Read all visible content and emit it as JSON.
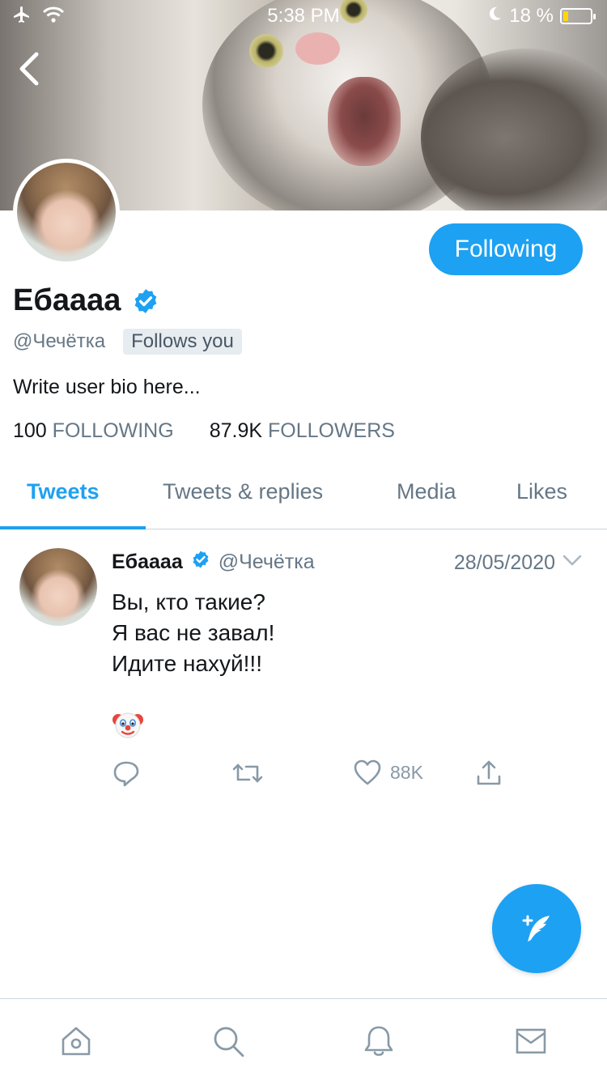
{
  "status_bar": {
    "time": "5:38 PM",
    "battery": "18 %",
    "battery_level": 0.18,
    "icons": [
      "airplane-icon",
      "wifi-icon",
      "moon-icon",
      "battery-charging-icon"
    ]
  },
  "profile": {
    "display_name": "Ебаааа",
    "handle": "@Чечётка",
    "follows_badge": "Follows you",
    "bio": "Write user bio here...",
    "following_count": "100",
    "following_label": "FOLLOWING",
    "followers_count": "87.9K",
    "followers_label": "FOLLOWERS",
    "follow_button": "Following",
    "verified": true
  },
  "tabs": [
    {
      "label": "Tweets",
      "active": true
    },
    {
      "label": "Tweets & replies",
      "active": false
    },
    {
      "label": "Media",
      "active": false
    },
    {
      "label": "Likes",
      "active": false
    }
  ],
  "tweet": {
    "name": "Ебаааа",
    "handle": "@Чечётка",
    "date": "28/05/2020",
    "lines": [
      "Вы, кто такие?",
      "Я вас не завал!",
      "Идите нахуй!!!"
    ],
    "emoji": "clown-face-icon",
    "like_count": "88K"
  },
  "colors": {
    "accent": "#1da1f2",
    "muted": "#657786"
  }
}
